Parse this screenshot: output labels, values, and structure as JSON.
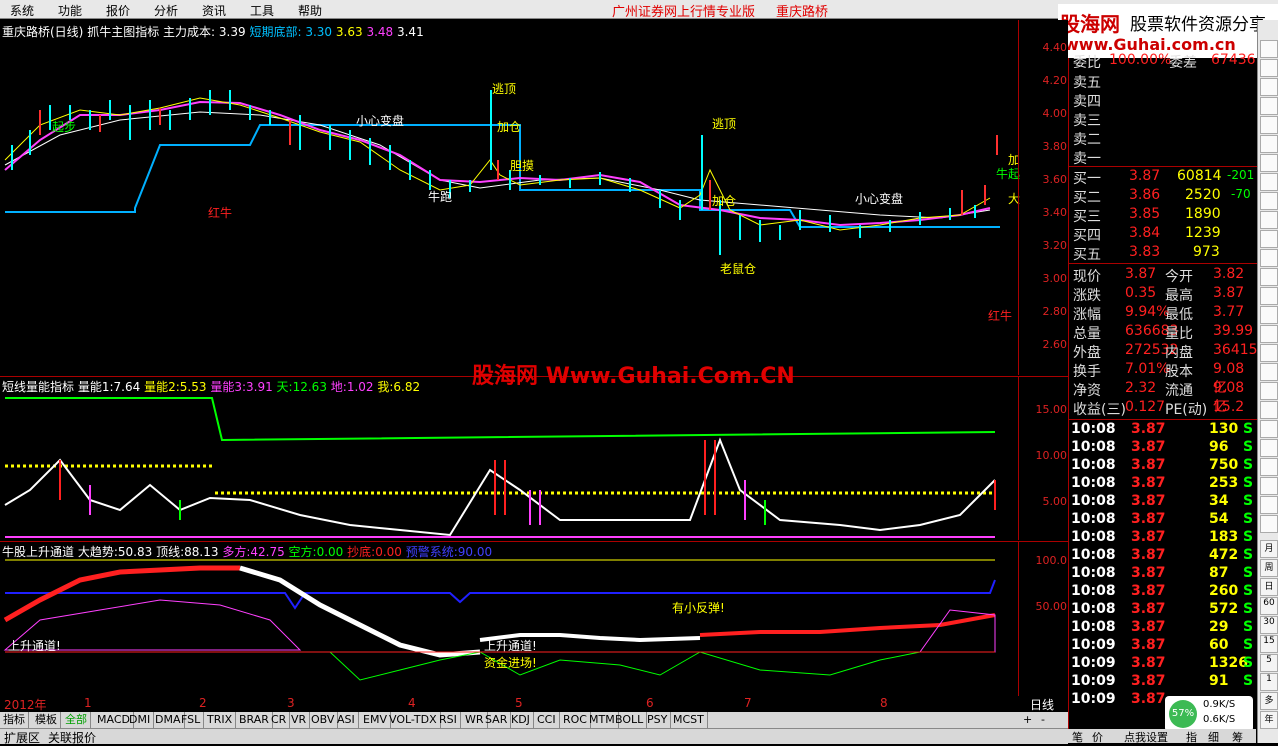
{
  "menu": {
    "items": [
      "系统",
      "功能",
      "报价",
      "分析",
      "资讯",
      "工具",
      "帮助"
    ],
    "title": "广州证券网上行情专业版",
    "stock": "重庆路桥"
  },
  "logo": {
    "main": "股海网",
    "sub": "股票软件资源分享",
    "url": "www.Guhai.com.cn"
  },
  "main_panel": {
    "name": "重庆路桥(日线)",
    "indicator": "抓牛主图指标",
    "cost_label": "主力成本:",
    "cost_value": "3.39",
    "short_label": "短期底部:",
    "short_values": [
      "3.30",
      "3.63",
      "3.48",
      "3.41"
    ],
    "y_ticks": [
      "4.40",
      "4.20",
      "4.00",
      "3.80",
      "3.60",
      "3.40",
      "3.20",
      "3.00",
      "2.80",
      "2.60"
    ],
    "annotations": [
      "逃顶",
      "加仓",
      "小心变盘",
      "起步",
      "红牛",
      "牛跑",
      "胆摸",
      "加仓",
      "逃顶",
      "老鼠仓",
      "小心变盘",
      "加",
      "牛起",
      "大",
      "红牛"
    ]
  },
  "volume_panel": {
    "label": "短线量能指标",
    "items": [
      {
        "k": "量能1:",
        "v": "7.64",
        "c": "#ffffff"
      },
      {
        "k": "量能2:",
        "v": "5.53",
        "c": "#ffff00"
      },
      {
        "k": "量能3:",
        "v": "3.91",
        "c": "#ff40ff"
      },
      {
        "k": "天:",
        "v": "12.63",
        "c": "#00ff00"
      },
      {
        "k": "地:",
        "v": "1.02",
        "c": "#ff40ff"
      },
      {
        "k": "我:",
        "v": "6.82",
        "c": "#ffff00"
      }
    ],
    "y_ticks": [
      "15.00",
      "10.00",
      "5.00"
    ]
  },
  "channel_panel": {
    "label": "牛股上升通道",
    "items": [
      {
        "k": "大趋势:",
        "v": "50.83",
        "c": "#ffffff"
      },
      {
        "k": "顶线:",
        "v": "88.13",
        "c": "#ffffff"
      },
      {
        "k": "多方:",
        "v": "42.75",
        "c": "#ff40ff"
      },
      {
        "k": "空方:",
        "v": "0.00",
        "c": "#00ff00"
      },
      {
        "k": "抄底:",
        "v": "0.00",
        "c": "#ff2020"
      },
      {
        "k": "预警系统:",
        "v": "90.00",
        "c": "#4040ff"
      }
    ],
    "y_ticks": [
      "100.0",
      "50.00"
    ],
    "annotations": [
      "上升通道!",
      "有小反弹!",
      "上升通道!",
      "资金进场!"
    ]
  },
  "time_axis": {
    "labels": [
      "2012年",
      "1",
      "2",
      "3",
      "4",
      "5",
      "6",
      "7",
      "8"
    ],
    "period": "日线"
  },
  "watermark": "股海网 Www.Guhai.Com.CN",
  "quotes": {
    "committee": [
      {
        "k": "委比",
        "v": "100.00%",
        "k2": "委差",
        "v2": "67436"
      }
    ],
    "sell": [
      {
        "k": "卖五"
      },
      {
        "k": "卖四"
      },
      {
        "k": "卖三"
      },
      {
        "k": "卖二"
      },
      {
        "k": "卖一"
      }
    ],
    "buy": [
      {
        "k": "买一",
        "p": "3.87",
        "q": "60814",
        "d": "-201"
      },
      {
        "k": "买二",
        "p": "3.86",
        "q": "2520",
        "d": "-70"
      },
      {
        "k": "买三",
        "p": "3.85",
        "q": "1890",
        "d": ""
      },
      {
        "k": "买四",
        "p": "3.84",
        "q": "1239",
        "d": ""
      },
      {
        "k": "买五",
        "p": "3.83",
        "q": "973",
        "d": ""
      }
    ],
    "stats": [
      {
        "k": "现价",
        "v": "3.87",
        "k2": "今开",
        "v2": "3.82"
      },
      {
        "k": "涨跌",
        "v": "0.35",
        "k2": "最高",
        "v2": "3.87"
      },
      {
        "k": "涨幅",
        "v": "9.94%",
        "k2": "最低",
        "v2": "3.77"
      },
      {
        "k": "总量",
        "v": "636683",
        "k2": "量比",
        "v2": "39.99"
      },
      {
        "k": "外盘",
        "v": "272532",
        "k2": "内盘",
        "v2": "364151"
      },
      {
        "k": "换手",
        "v": "7.01%",
        "k2": "股本",
        "v2": "9.08亿"
      },
      {
        "k": "净资",
        "v": "2.32",
        "k2": "流通",
        "v2": "9.08亿"
      },
      {
        "k": "收益(三)",
        "v": "0.127",
        "k2": "PE(动)",
        "v2": "15.2"
      }
    ],
    "ticks": [
      {
        "t": "10:08",
        "p": "3.87",
        "q": "130",
        "s": "S"
      },
      {
        "t": "10:08",
        "p": "3.87",
        "q": "96",
        "s": "S"
      },
      {
        "t": "10:08",
        "p": "3.87",
        "q": "750",
        "s": "S"
      },
      {
        "t": "10:08",
        "p": "3.87",
        "q": "253",
        "s": "S"
      },
      {
        "t": "10:08",
        "p": "3.87",
        "q": "34",
        "s": "S"
      },
      {
        "t": "10:08",
        "p": "3.87",
        "q": "54",
        "s": "S"
      },
      {
        "t": "10:08",
        "p": "3.87",
        "q": "183",
        "s": "S"
      },
      {
        "t": "10:08",
        "p": "3.87",
        "q": "472",
        "s": "S"
      },
      {
        "t": "10:08",
        "p": "3.87",
        "q": "87",
        "s": "S"
      },
      {
        "t": "10:08",
        "p": "3.87",
        "q": "260",
        "s": "S"
      },
      {
        "t": "10:08",
        "p": "3.87",
        "q": "572",
        "s": "S"
      },
      {
        "t": "10:08",
        "p": "3.87",
        "q": "29",
        "s": "S"
      },
      {
        "t": "10:09",
        "p": "3.87",
        "q": "60",
        "s": "S"
      },
      {
        "t": "10:09",
        "p": "3.87",
        "q": "1326",
        "s": "S"
      },
      {
        "t": "10:09",
        "p": "3.87",
        "q": "91",
        "s": "S"
      },
      {
        "t": "10:09",
        "p": "3.87",
        "q": "",
        "s": ""
      }
    ]
  },
  "tabs": [
    "指标",
    "模板",
    "全部",
    "MACD",
    "DMI",
    "DMA",
    "FSL",
    "TRIX",
    "BRAR",
    "CR",
    "VR",
    "OBV",
    "ASI",
    "EMV",
    "VOL-TDX",
    "RSI",
    "WR",
    "SAR",
    "KDJ",
    "CCI",
    "ROC",
    "MTM",
    "BOLL",
    "PSY",
    "MCST"
  ],
  "bottom": {
    "left": [
      "扩展区",
      "关联报价"
    ],
    "right": [
      "笔",
      "价",
      "点我设置",
      "指",
      "细",
      "筹"
    ]
  },
  "net": {
    "pct": "57%",
    "up": "0.9K/S",
    "down": "0.6K/S"
  },
  "sidebar": [
    "月",
    "周",
    "日",
    "60",
    "30",
    "15",
    "5",
    "1",
    "多",
    "年"
  ]
}
